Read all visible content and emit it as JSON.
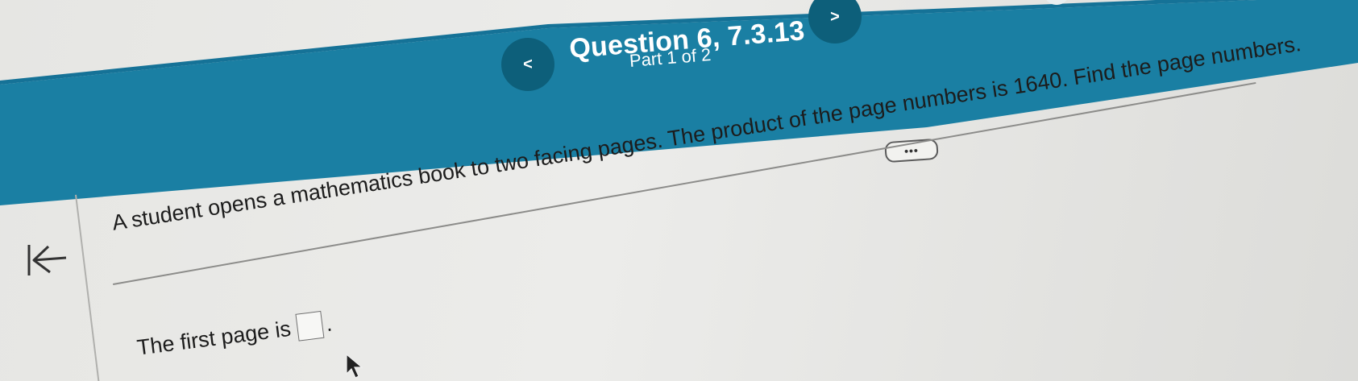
{
  "header": {
    "title": "Question 6, 7.3.13",
    "part": "Part 1 of 2",
    "prev_label": "<",
    "next_label": ">",
    "band_color": "#1a7fa3"
  },
  "toolbar": {
    "more_label": "•••"
  },
  "question": {
    "text": "A student opens a mathematics book to two facing pages. The product of the page numbers is 1640. Find the page numbers."
  },
  "answer": {
    "prompt": "The first page is",
    "value": "",
    "suffix": "."
  },
  "icons": {
    "back": "collapse-left-arrow-icon",
    "cursor": "mouse-pointer-icon"
  }
}
